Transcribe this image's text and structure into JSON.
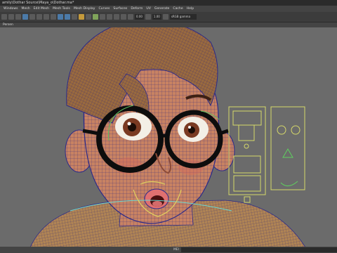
{
  "window": {
    "title": "amily\\Dothar Source\\Maya_o\\Dothar.ma*"
  },
  "menu": [
    "Windows",
    "Mesh",
    "Edit Mesh",
    "Mesh Tools",
    "Mesh Display",
    "Curves",
    "Surfaces",
    "Deform",
    "UV",
    "Generate",
    "Cache",
    "Help"
  ],
  "toolbar": {
    "value1": "0.00",
    "value2": "1.00",
    "colorspace": "sRGB gamma"
  },
  "panel": {
    "label": "Persen"
  },
  "status": {
    "label": "MEI"
  },
  "colors": {
    "skin": "#c88262",
    "hair": "#9a6a3e",
    "wire": "#2b2a8a",
    "controls": "#d6d86a",
    "iris": "#7a3a22"
  }
}
